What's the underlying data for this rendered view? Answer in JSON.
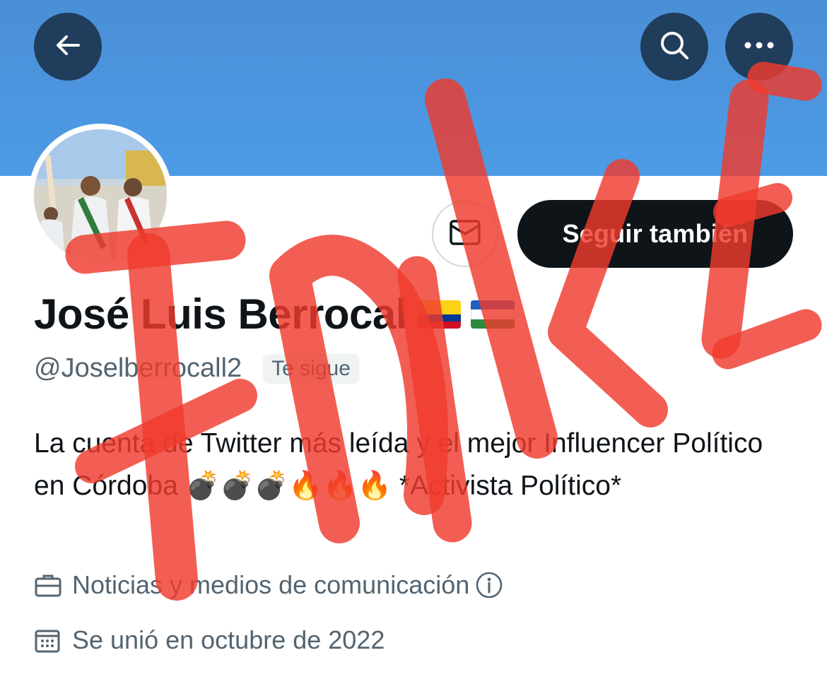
{
  "profile": {
    "name": "José Luis Berrocal",
    "handle": "@Joselberrocall2",
    "follows_you_badge": "Te sigue",
    "bio": "La cuenta de Twitter más leída y el mejor Influencer Político en Córdoba 💣💣💣🔥🔥🔥 *Activista Político*",
    "category": "Noticias y medios de comunicación",
    "joined": "Se unió en octubre de 2022"
  },
  "actions": {
    "follow_back_label": "Seguir también"
  },
  "icons": {
    "back": "arrow-left-icon",
    "search": "search-icon",
    "more": "more-horizontal-icon",
    "message": "envelope-icon",
    "category": "briefcase-icon",
    "info": "info-circle-icon",
    "joined": "calendar-icon"
  },
  "colors": {
    "banner": "#4a8fd6",
    "nav_button": "#213d5c",
    "follow_button": "#0f1419",
    "secondary_text": "#536471",
    "overlay_stamp": "#ef3b2d"
  },
  "overlay": {
    "stamp_text": "FAKE"
  }
}
